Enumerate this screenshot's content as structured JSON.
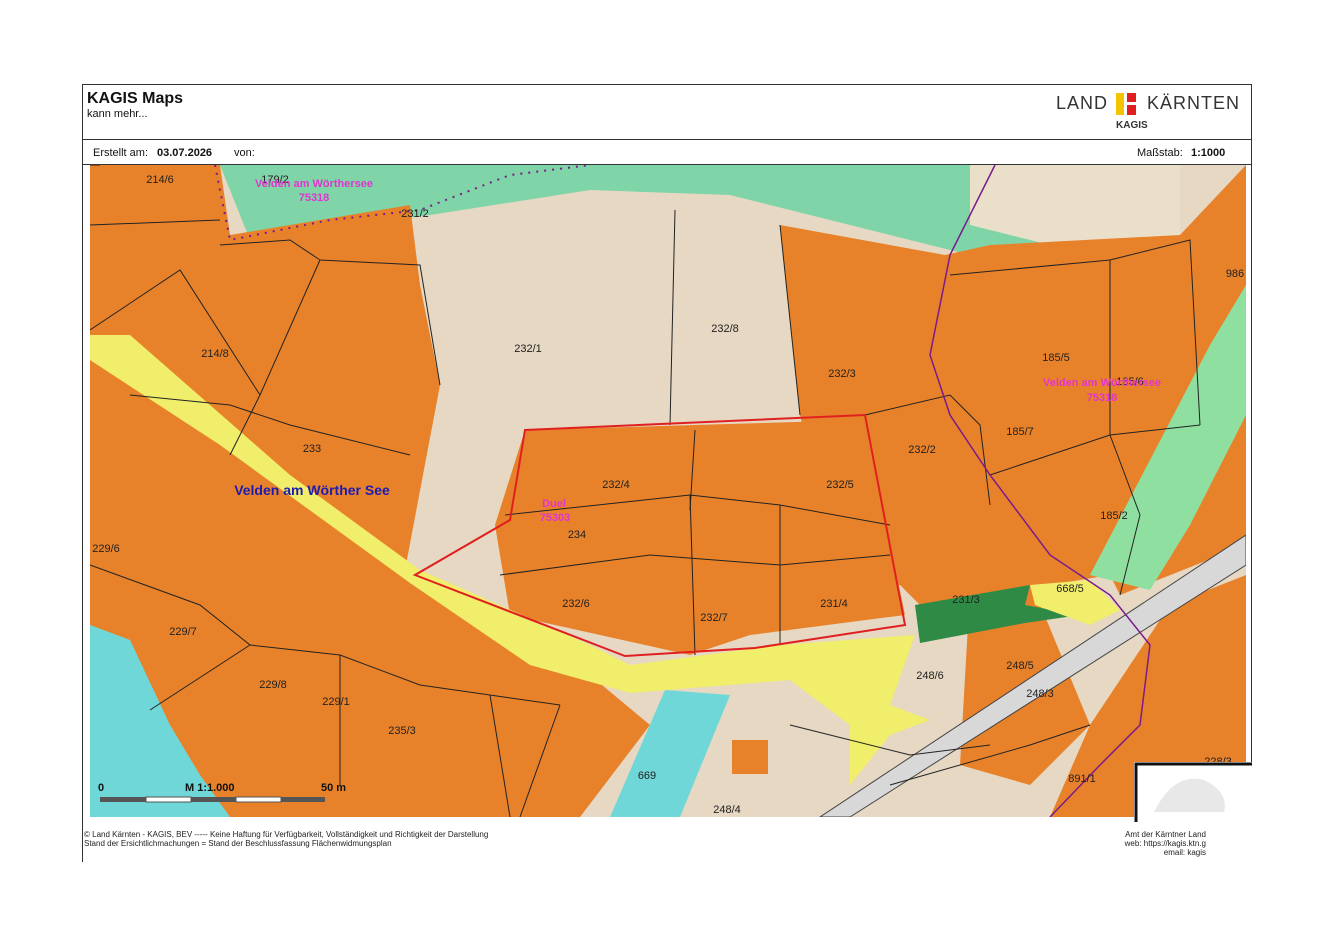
{
  "header": {
    "title": "KAGIS Maps",
    "subtitle": "kann mehr...",
    "logo_land": "LAND",
    "logo_karnten": "KÄRNTEN",
    "logo_kagis": "KAGIS"
  },
  "info": {
    "created_label": "Erstellt am:",
    "created_date": "03.07.2026",
    "by_label": "von:",
    "scale_label": "Maßstab:",
    "scale_value": "1:1000"
  },
  "colors": {
    "built": "#e8822a",
    "road": "#f0ee6a",
    "meadow": "#e6d8c2",
    "forest": "#7fd4a8",
    "water": "#6fd7d8",
    "highlight": "#e02020",
    "boundary": "#7a1a8c",
    "green_dark": "#2f8a46"
  },
  "parcels": [
    "214/6",
    "179/2",
    "231/2",
    "214/8",
    "233",
    "232/1",
    "232/8",
    "232/3",
    "185/5",
    "185/6",
    "986",
    "232/4",
    "232/5",
    "232/2",
    "185/7",
    "234",
    "229/6",
    "232/6",
    "232/7",
    "231/4",
    "231/3",
    "668/5",
    "185/2",
    "229/7",
    "229/8",
    "229/1",
    "235/3",
    "248/6",
    "248/5",
    "248/3",
    "669",
    "248/4",
    "891/1",
    "228/3"
  ],
  "place_labels": {
    "velden_a": "Velden am Wörthersee",
    "velden_a_code": "75318",
    "velden_b": "Velden am Wörthersee",
    "velden_b_code": "75318",
    "duel": "Duel",
    "duel_code": "75303",
    "municipality": "Velden am Wörther See"
  },
  "scalebar": {
    "left": "0",
    "middle": "M 1:1.000",
    "right": "50 m"
  },
  "footer": {
    "line1": "© Land Kärnten - KAGIS, BEV ----- Keine Haftung für Verfügbarkeit, Vollständigkeit und Richtigkeit der Darstellung",
    "line2": "Stand der Ersichtlichmachungen = Stand der Beschlussfassung Flächenwidmungsplan",
    "right1": "Amt der Kärntner Land",
    "right2": "web: https://kagis.ktn.g",
    "right3": "email: kagis"
  }
}
